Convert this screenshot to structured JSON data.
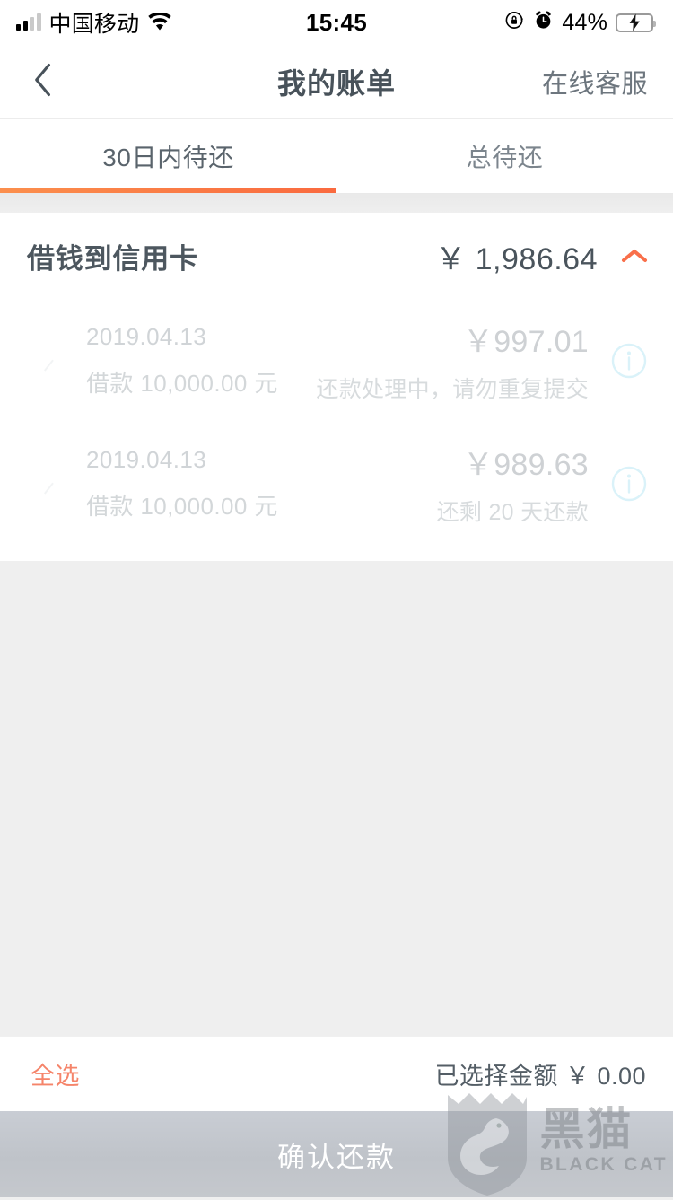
{
  "status_bar": {
    "carrier": "中国移动",
    "signal_icon": "signal-bars-icon",
    "wifi_icon": "wifi-icon",
    "time": "15:45",
    "rotation_lock_icon": "rotation-lock-icon",
    "alarm_icon": "alarm-clock-icon",
    "battery_percent": "44%",
    "battery_icon": "battery-charging-icon",
    "battery_level": 41
  },
  "nav": {
    "back_icon": "chevron-left-icon",
    "title": "我的账单",
    "action_label": "在线客服"
  },
  "tabs": {
    "items": [
      {
        "label": "30日内待还",
        "active": true
      },
      {
        "label": "总待还",
        "active": false
      }
    ],
    "accent_color": "#fa6a3f"
  },
  "card": {
    "title": "借钱到信用卡",
    "amount": "￥ 1,986.64",
    "collapse_icon": "chevron-up-icon",
    "collapse_icon_color": "#f96f4a",
    "rows": [
      {
        "checkbox_icon": "checkbox-icon",
        "date": "2019.04.13",
        "principal": "借款 10,000.00 元",
        "amount": "￥997.01",
        "status": "还款处理中，请勿重复提交",
        "info_icon": "info-circle-icon"
      },
      {
        "checkbox_icon": "checkbox-icon",
        "date": "2019.04.13",
        "principal": "借款 10,000.00 元",
        "amount": "￥989.63",
        "status": "还剩 20 天还款",
        "info_icon": "info-circle-icon"
      }
    ]
  },
  "bottom_bar": {
    "select_all_label": "全选",
    "select_all_color": "#f5846a",
    "selected_amount_label": "已选择金额 ￥ 0.00",
    "confirm_label": "确认还款",
    "confirm_disabled": true
  },
  "watermark": {
    "shield_icon": "black-cat-shield-icon",
    "cn_text": "黑猫",
    "en_text": "BLACK CAT"
  }
}
